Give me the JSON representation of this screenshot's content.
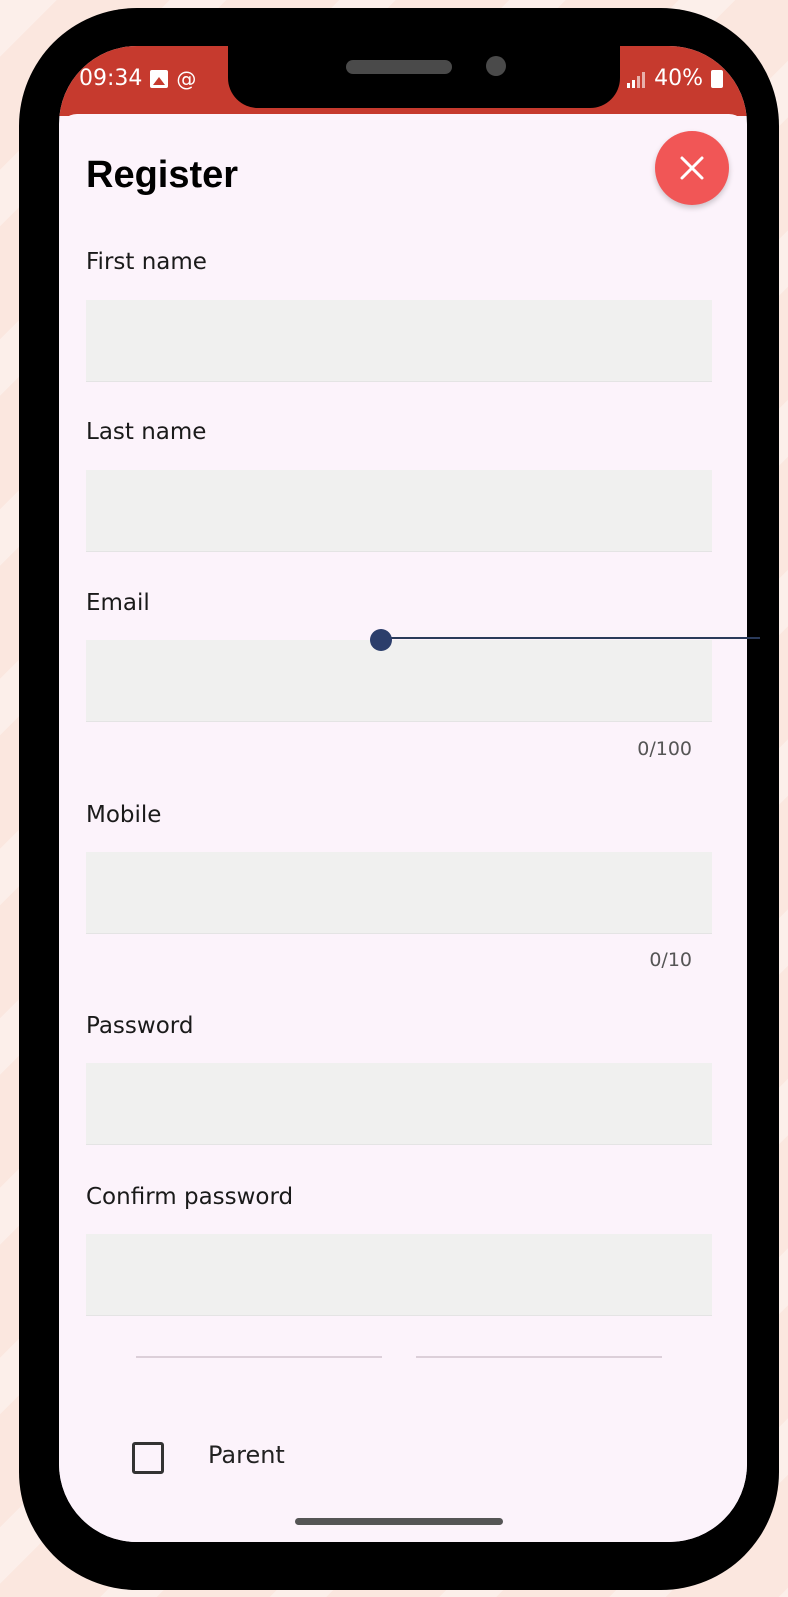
{
  "statusbar": {
    "time": "09:34",
    "battery": "40%"
  },
  "sheet": {
    "title": "Register",
    "close_icon": "close-icon"
  },
  "fields": {
    "first_name": {
      "label": "First name",
      "value": ""
    },
    "last_name": {
      "label": "Last name",
      "value": ""
    },
    "email": {
      "label": "Email",
      "value": "",
      "counter": "0/100"
    },
    "mobile": {
      "label": "Mobile",
      "value": "",
      "counter": "0/10"
    },
    "password": {
      "label": "Password",
      "value": ""
    },
    "confirm_password": {
      "label": "Confirm password",
      "value": ""
    }
  },
  "parent_checkbox": {
    "label": "Parent",
    "checked": false
  },
  "colors": {
    "statusbar": "#c63a2e",
    "close_button": "#f15656",
    "sheet_bg": "#fcf3fb",
    "input_bg": "#f0f0ef"
  }
}
